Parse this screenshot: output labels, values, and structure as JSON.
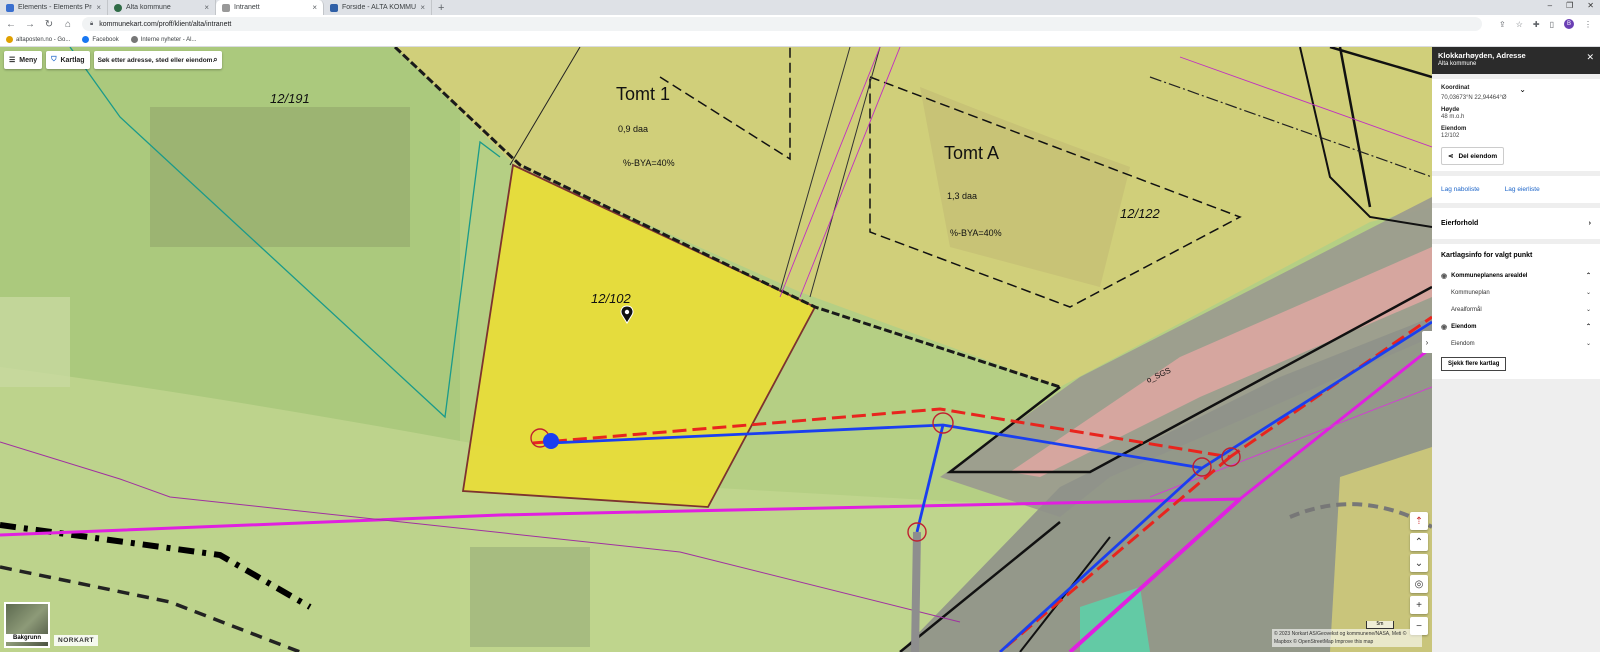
{
  "browser": {
    "tabs": [
      {
        "title": "Elements - Elements Produksjon",
        "active": false,
        "color": "#3a6fcf"
      },
      {
        "title": "Alta kommune",
        "active": false,
        "color": "#2f6b46"
      },
      {
        "title": "Intranett",
        "active": true,
        "color": "#999999"
      },
      {
        "title": "Forside - ALTA KOMMUNE",
        "active": false,
        "color": "#2f5fa6"
      }
    ],
    "new_tab": "+",
    "url": "kommunekart.com/proff/klient/alta/intranett",
    "profile_initial": "B",
    "bookmarks": [
      {
        "label": "altaposten.no - Go...",
        "color": "#e0a000"
      },
      {
        "label": "Facebook",
        "color": "#1877f2"
      },
      {
        "label": "Interne nyheter - Al...",
        "color": "#777777"
      }
    ]
  },
  "map": {
    "toolbar": {
      "menu_label": "Meny",
      "layers_label": "Kartlag",
      "search_placeholder": "Søk etter adresse, sted eller eiendom"
    },
    "labels": {
      "parcel_191": "12/191",
      "tomt1": "Tomt 1",
      "tomt1_area": "0,9 daa",
      "tomt1_bya": "%-BYA=40%",
      "parcel_102": "12/102",
      "tomtA": "Tomt A",
      "tomtA_area": "1,3 daa",
      "tomtA_bya": "%-BYA=40%",
      "parcel_122": "12/122",
      "road_code": "o_SGS"
    },
    "background_label": "Bakgrunn",
    "brand": "NORKART",
    "scale_label": "5m",
    "attribution": "© 2023 Norkart AS/Geovekst og kommunene/NASA, Meti © Mapbox © OpenStreetMap Improve this map"
  },
  "panel": {
    "title": "Klokkarhøyden, Adresse",
    "subtitle": "Alta kommune",
    "coord_label": "Koordinat",
    "coord_value": "70,03673°N 22,94464°Ø",
    "height_label": "Høyde",
    "height_value": "48 m.o.h",
    "property_label": "Eiendom",
    "property_value": "12/102",
    "share_button": "Del eiendom",
    "link_neighbors": "Lag naboliste",
    "link_owners": "Lag eierliste",
    "ownership": "Eierforhold",
    "layerinfo_title": "Kartlagsinfo for valgt punkt",
    "layers": [
      {
        "label": "Kommuneplanens arealdel",
        "type": "group"
      },
      {
        "label": "Kommuneplan",
        "type": "sub"
      },
      {
        "label": "Arealformål",
        "type": "sub"
      },
      {
        "label": "Eiendom",
        "type": "group"
      },
      {
        "label": "Eiendom",
        "type": "sub"
      }
    ],
    "more_layers_button": "Sjekk flere kartlag"
  }
}
